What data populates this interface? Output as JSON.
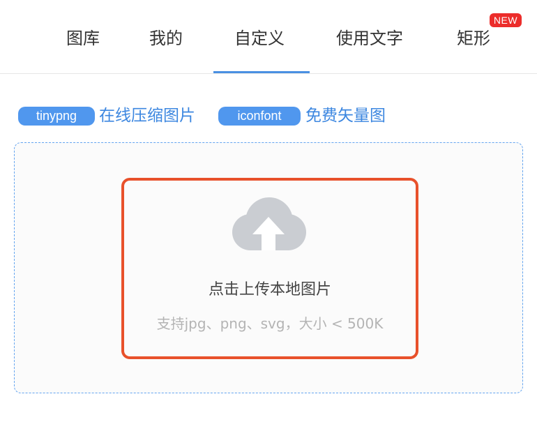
{
  "tabs": {
    "items": [
      {
        "label": "图库"
      },
      {
        "label": "我的"
      },
      {
        "label": "自定义",
        "active": true
      },
      {
        "label": "使用文字"
      },
      {
        "label": "矩形"
      }
    ],
    "new_badge": "NEW"
  },
  "links": {
    "tinypng": {
      "badge": "tinypng",
      "text": "在线压缩图片"
    },
    "iconfont": {
      "badge": "iconfont",
      "text": "免费矢量图"
    }
  },
  "upload": {
    "title": "点击上传本地图片",
    "hint": "支持jpg、png、svg，大小 < 500K",
    "icon": "cloud-upload-icon"
  },
  "colors": {
    "accent": "#4a90e2",
    "badge_red": "#ec2d2b",
    "focus_border": "#e8512b",
    "dashed_border": "#63a4f0",
    "icon_gray": "#cacdd2"
  }
}
